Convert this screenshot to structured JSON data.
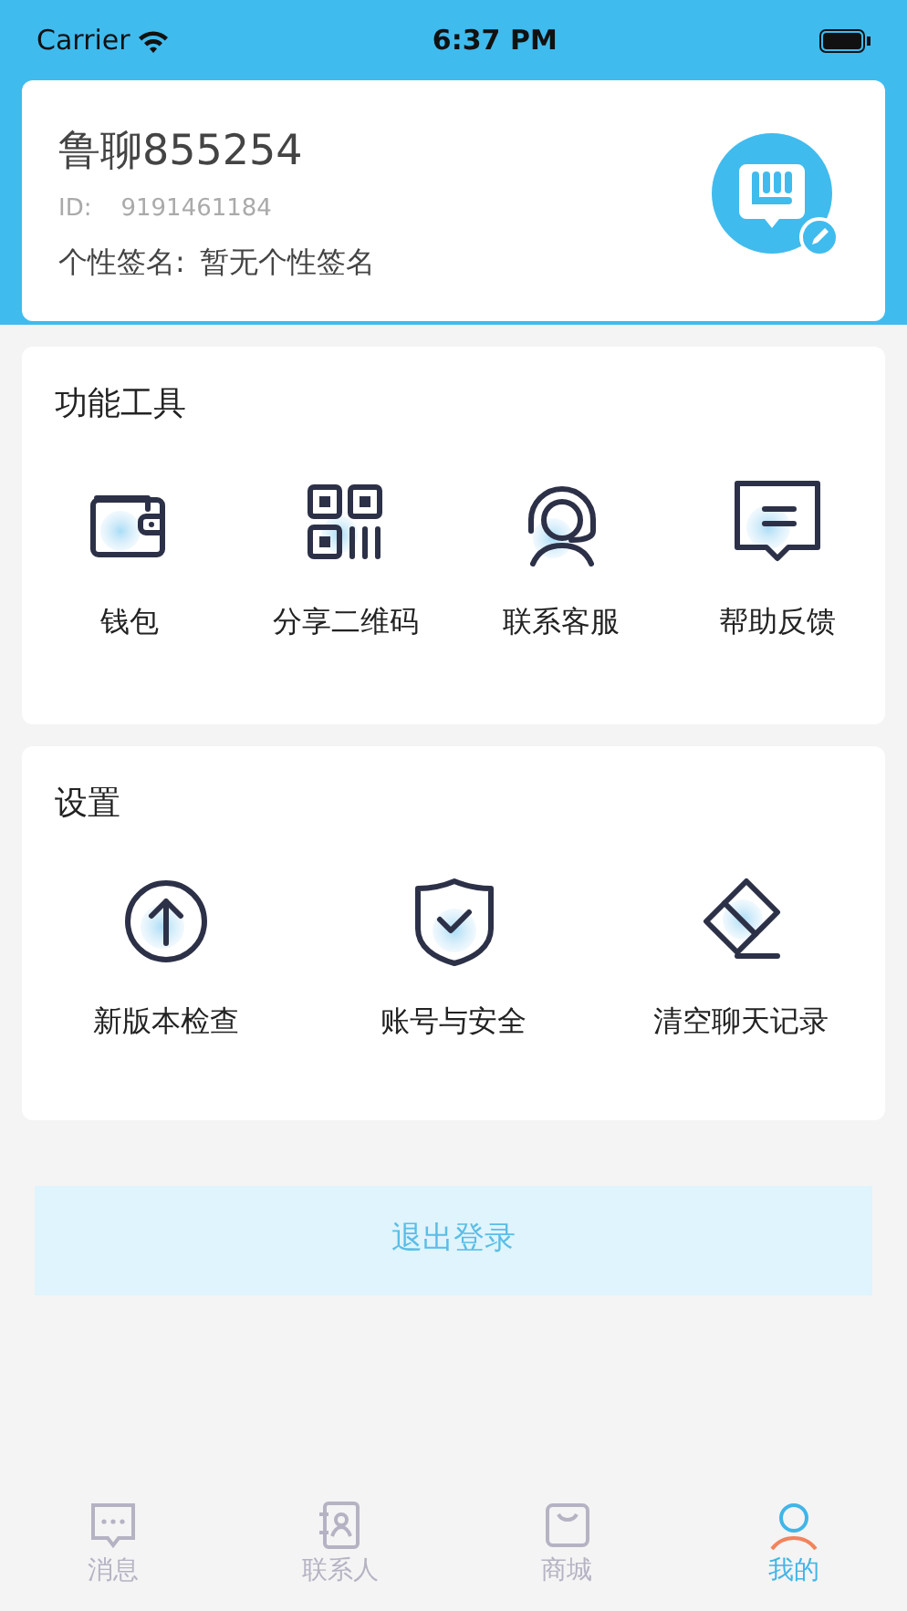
{
  "status_bar": {
    "carrier": "Carrier",
    "time": "6:37 PM"
  },
  "profile": {
    "name": "鲁聊855254",
    "id_label": "ID:",
    "id": "9191461184",
    "signature_label": "个性签名:",
    "signature": "暂无个性签名"
  },
  "tools": {
    "title": "功能工具",
    "items": [
      {
        "label": "钱包"
      },
      {
        "label": "分享二维码"
      },
      {
        "label": "联系客服"
      },
      {
        "label": "帮助反馈"
      }
    ]
  },
  "settings": {
    "title": "设置",
    "items": [
      {
        "label": "新版本检查"
      },
      {
        "label": "账号与安全"
      },
      {
        "label": "清空聊天记录"
      }
    ]
  },
  "logout_button": "退出登录",
  "tabs": [
    {
      "label": "消息",
      "selected": false
    },
    {
      "label": "联系人",
      "selected": false
    },
    {
      "label": "商城",
      "selected": false
    },
    {
      "label": "我的",
      "selected": true
    }
  ]
}
